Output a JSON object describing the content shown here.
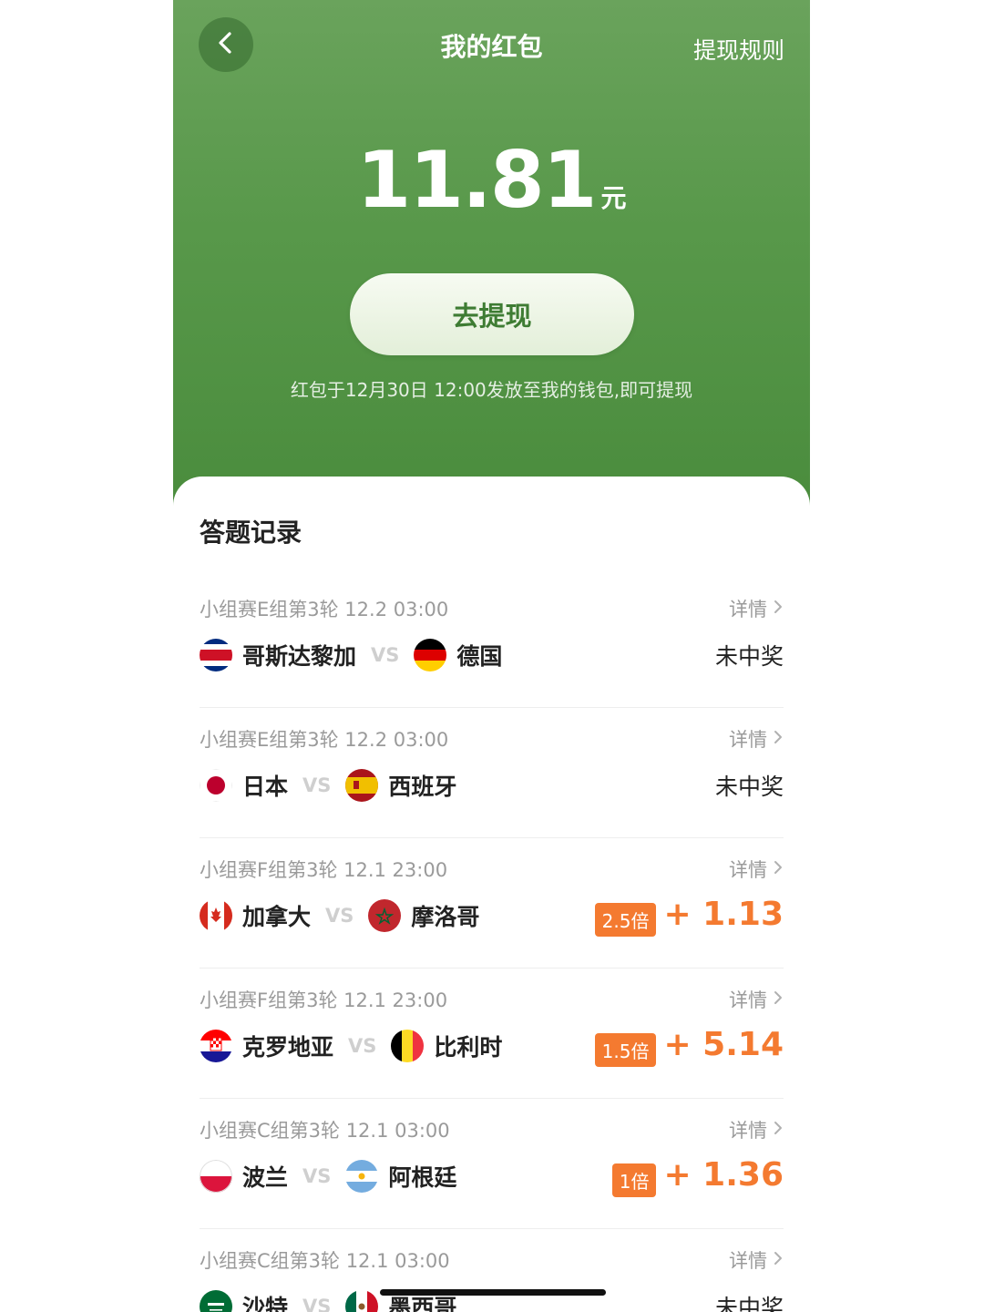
{
  "header": {
    "title": "我的红包",
    "rules_link": "提现规则"
  },
  "balance": {
    "amount": "11.81",
    "unit": "元"
  },
  "withdraw_button": "去提现",
  "notice": "红包于12月30日 12:00发放至我的钱包,即可提现",
  "records": {
    "section_title": "答题记录",
    "detail_label": "详情",
    "vs_label": "VS",
    "items": [
      {
        "meta": "小组赛E组第3轮 12.2 03:00",
        "team_a": "哥斯达黎加",
        "flag_a": "costa-rica",
        "team_b": "德国",
        "flag_b": "germany",
        "result": "未中奖"
      },
      {
        "meta": "小组赛E组第3轮 12.2 03:00",
        "team_a": "日本",
        "flag_a": "japan",
        "team_b": "西班牙",
        "flag_b": "spain",
        "result": "未中奖"
      },
      {
        "meta": "小组赛F组第3轮 12.1 23:00",
        "team_a": "加拿大",
        "flag_a": "canada",
        "team_b": "摩洛哥",
        "flag_b": "morocco",
        "multiplier": "2.5倍",
        "reward": "+ 1.13"
      },
      {
        "meta": "小组赛F组第3轮 12.1 23:00",
        "team_a": "克罗地亚",
        "flag_a": "croatia",
        "team_b": "比利时",
        "flag_b": "belgium",
        "multiplier": "1.5倍",
        "reward": "+ 5.14"
      },
      {
        "meta": "小组赛C组第3轮 12.1 03:00",
        "team_a": "波兰",
        "flag_a": "poland",
        "team_b": "阿根廷",
        "flag_b": "argentina",
        "multiplier": "1倍",
        "reward": "+ 1.36"
      },
      {
        "meta": "小组赛C组第3轮 12.1 03:00",
        "team_a": "沙特",
        "flag_a": "saudi-arabia",
        "team_b": "墨西哥",
        "flag_b": "mexico",
        "result": "未中奖"
      }
    ]
  },
  "colors": {
    "header_green": "#58984a",
    "button_text_green": "#3e7c33",
    "reward_orange": "#f47a30"
  },
  "icons": {
    "back": "chevron-left-icon",
    "detail": "chevron-right-icon"
  }
}
